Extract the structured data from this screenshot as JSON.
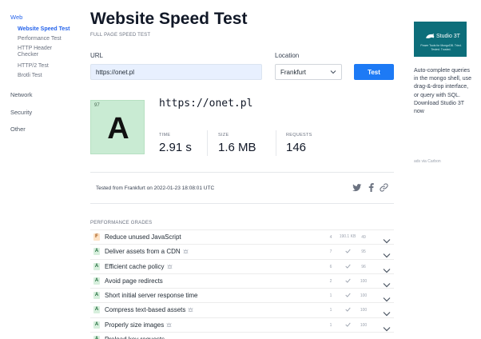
{
  "sidebar": {
    "sections": [
      {
        "label": "Web",
        "active": true,
        "items": [
          {
            "label": "Website Speed Test",
            "active": true
          },
          {
            "label": "Performance Test",
            "active": false
          },
          {
            "label": "HTTP Header Checker",
            "active": false
          },
          {
            "label": "HTTP/2 Test",
            "active": false
          },
          {
            "label": "Brotli Test",
            "active": false
          }
        ]
      },
      {
        "label": "Network",
        "active": false,
        "items": []
      },
      {
        "label": "Security",
        "active": false,
        "items": []
      },
      {
        "label": "Other",
        "active": false,
        "items": []
      }
    ]
  },
  "page": {
    "title": "Website Speed Test",
    "subtitle": "FULL PAGE SPEED TEST"
  },
  "form": {
    "url_label": "URL",
    "url_value": "https://onet.pl",
    "location_label": "Location",
    "location_value": "Frankfurt",
    "test_label": "Test"
  },
  "result": {
    "score": "97",
    "grade": "A",
    "url": "https://onet.pl",
    "metrics": [
      {
        "label": "TIME",
        "value": "2.91 s"
      },
      {
        "label": "SIZE",
        "value": "1.6 MB"
      },
      {
        "label": "REQUESTS",
        "value": "146"
      }
    ],
    "tested_text": "Tested from Frankfurt on 2022-01-23 18:08:01 UTC"
  },
  "share": {
    "icons": [
      "twitter-icon",
      "facebook-icon",
      "link-icon"
    ]
  },
  "grades": {
    "heading": "PERFORMANCE GRADES",
    "rows": [
      {
        "grade": "F",
        "title": "Reduce unused JavaScript",
        "warn": false,
        "count": "4",
        "size": "190.1 KB",
        "score": "49"
      },
      {
        "grade": "A",
        "title": "Deliver assets from a CDN",
        "warn": true,
        "count": "7",
        "size": "",
        "score": "95"
      },
      {
        "grade": "A",
        "title": "Efficient cache policy",
        "warn": true,
        "count": "6",
        "size": "",
        "score": "96"
      },
      {
        "grade": "A",
        "title": "Avoid page redirects",
        "warn": false,
        "count": "2",
        "size": "",
        "score": "100"
      },
      {
        "grade": "A",
        "title": "Short initial server response time",
        "warn": false,
        "count": "1",
        "size": "",
        "score": "100"
      },
      {
        "grade": "A",
        "title": "Compress text-based assets",
        "warn": true,
        "count": "1",
        "size": "",
        "score": "100"
      },
      {
        "grade": "A",
        "title": "Properly size images",
        "warn": true,
        "count": "1",
        "size": "",
        "score": "100"
      },
      {
        "grade": "A",
        "title": "Preload key requests",
        "warn": false,
        "count": "",
        "size": "",
        "score": ""
      }
    ]
  },
  "ad": {
    "brand": "Studio 3T",
    "tagline": "Power Tools for MongoDB. Tried. Tested. Trusted.",
    "text": "Auto-complete queries in the mongo shell, use drag-&-drop interface, or query with SQL. Download Studio 3T now",
    "credit": "ads via Carbon"
  },
  "colors": {
    "accent": "#1d7af5",
    "grade_a_bg": "#c9ebd3",
    "grade_f_bg": "#fde3c7"
  }
}
